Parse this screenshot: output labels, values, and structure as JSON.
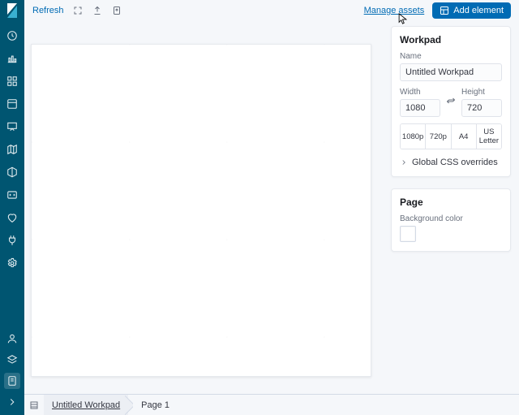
{
  "toolbar": {
    "refresh_label": "Refresh",
    "manage_assets_label": "Manage assets",
    "add_element_label": "Add element"
  },
  "workpad_panel": {
    "title": "Workpad",
    "name_label": "Name",
    "name_value": "Untitled Workpad",
    "width_label": "Width",
    "width_value": "1080",
    "height_label": "Height",
    "height_value": "720",
    "presets": [
      "1080p",
      "720p",
      "A4",
      "US Letter"
    ],
    "css_overrides_label": "Global CSS overrides"
  },
  "page_panel": {
    "title": "Page",
    "bg_label": "Background color",
    "bg_value": "#ffffff"
  },
  "bottombar": {
    "workpad_crumb": "Untitled Workpad",
    "page_crumb": "Page 1"
  },
  "nav_icons": [
    "clock-icon",
    "graph-icon",
    "dashboard-icon",
    "timeline-icon",
    "presentation-icon",
    "map-icon",
    "infra-icon",
    "code-icon",
    "heart-icon",
    "plug-icon",
    "gear-icon"
  ],
  "nav_bottom_icons": [
    "user-icon",
    "layers-icon",
    "docs-icon",
    "collapse-icon"
  ],
  "colors": {
    "accent": "#006bb4",
    "rail": "#005571"
  }
}
